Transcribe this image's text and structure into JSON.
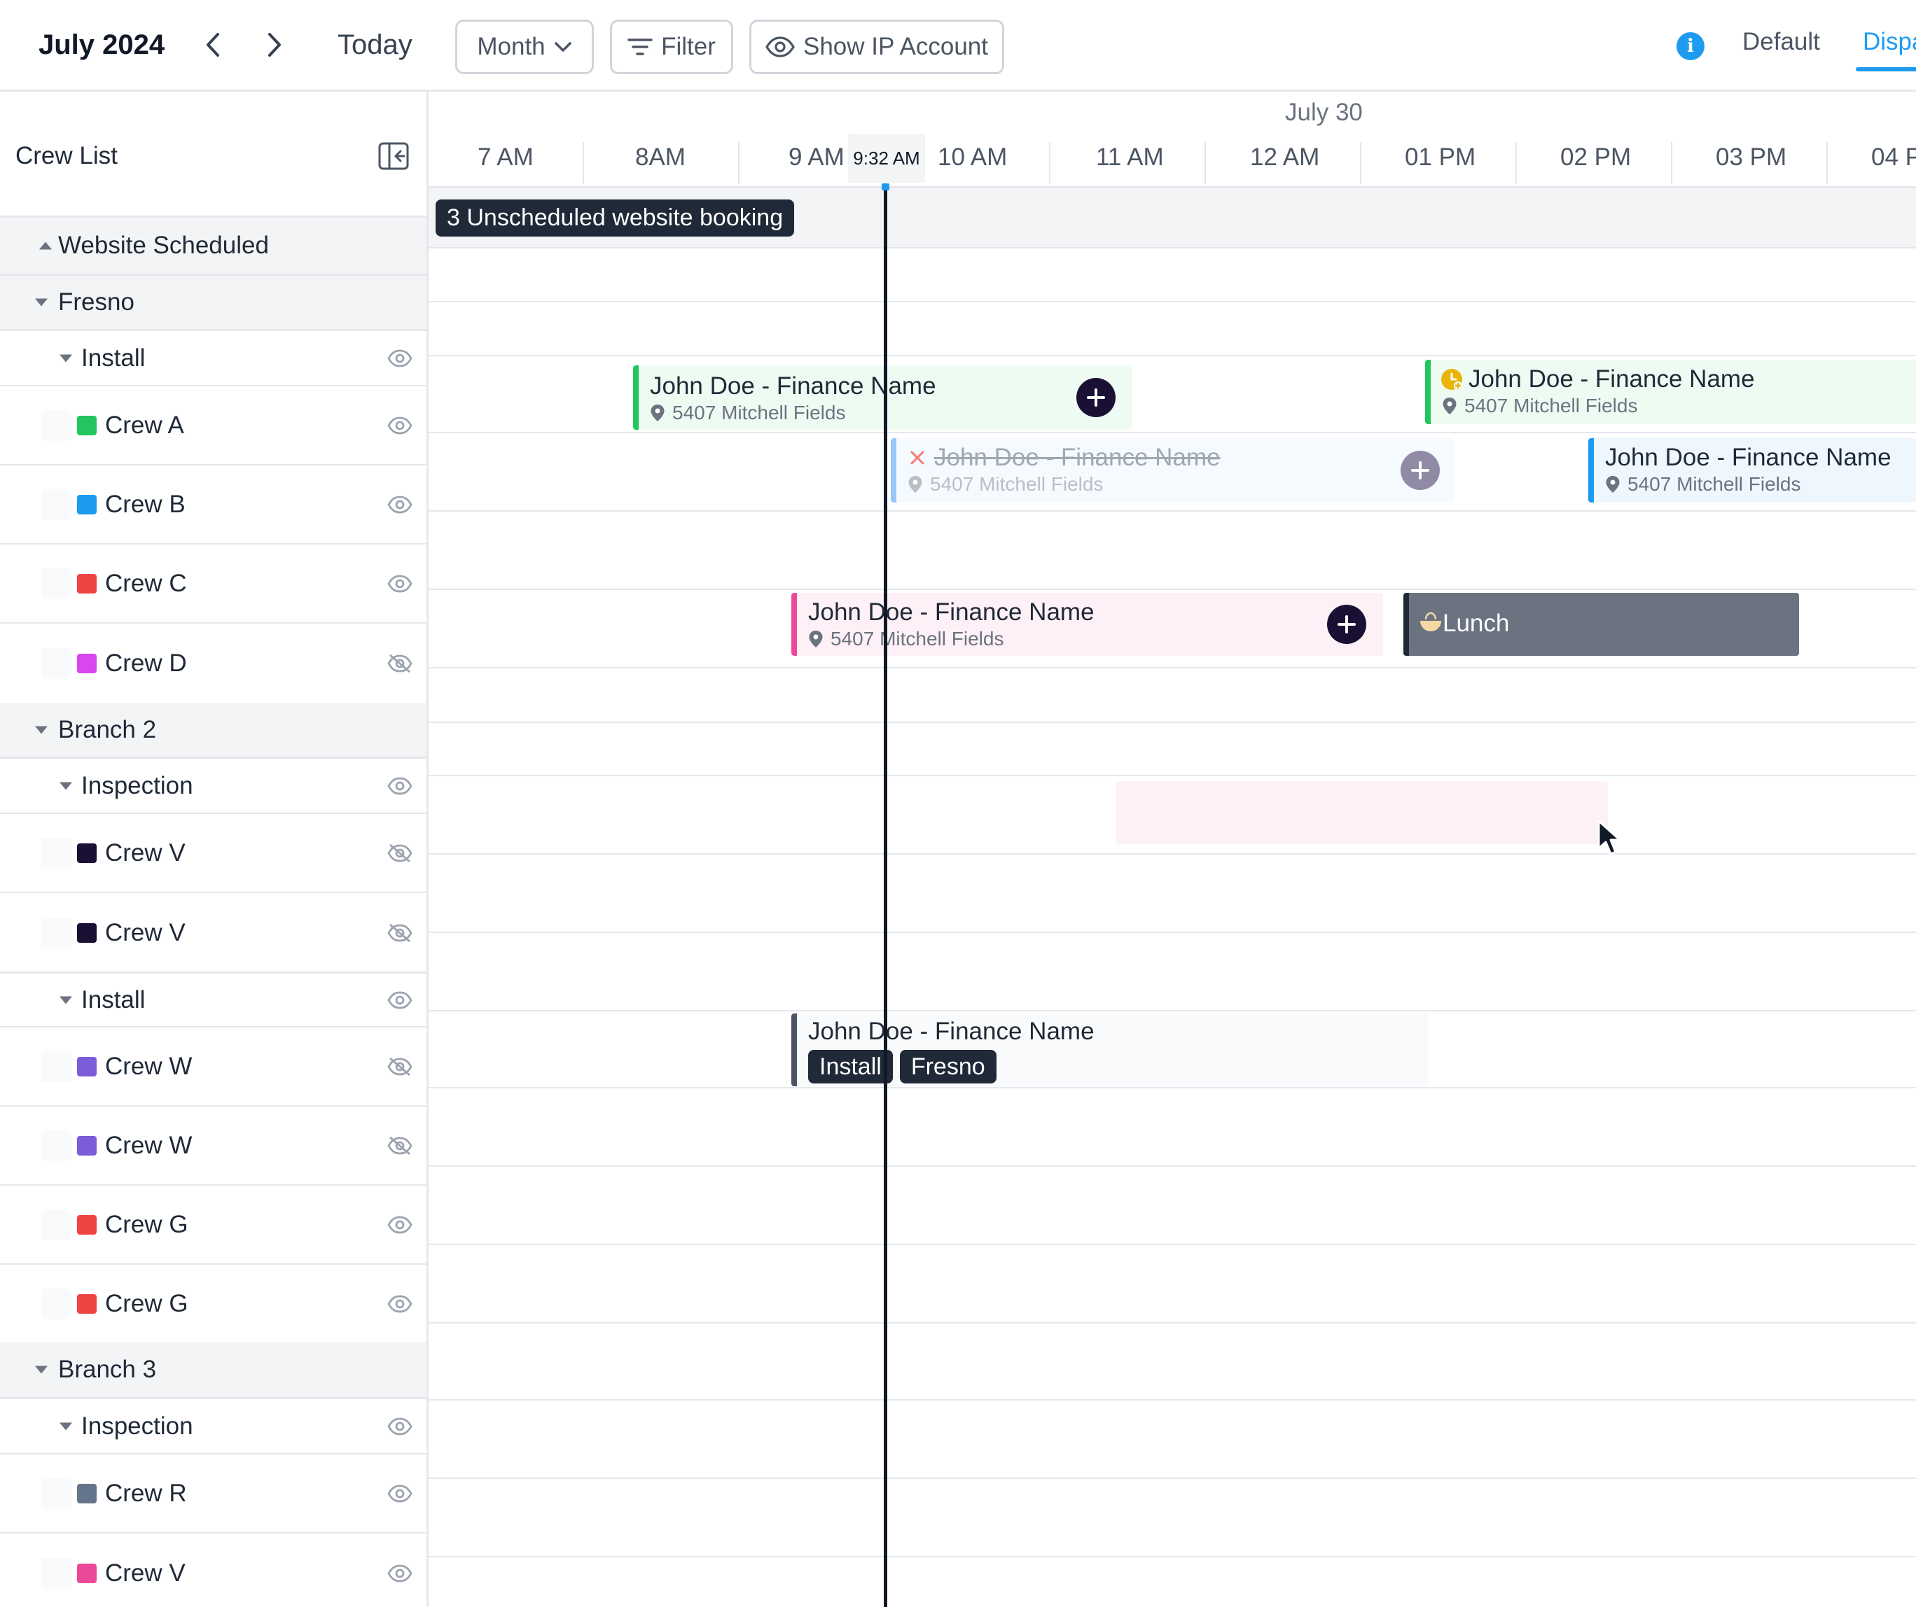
{
  "toolbar": {
    "title": "July 2024",
    "today_label": "Today",
    "view_select": "Month",
    "filter_label": "Filter",
    "show_ip_label": "Show IP Account",
    "info_icon": "i",
    "tabs": [
      {
        "label": "Default"
      },
      {
        "label": "Dispa"
      }
    ]
  },
  "panel": {
    "title": "Crew List",
    "rows": [
      {
        "label": "Website Scheduled"
      },
      {
        "label": "Fresno"
      },
      {
        "label": "Install"
      },
      {
        "label": "Crew A",
        "color": "#22c55e"
      },
      {
        "label": "Crew B",
        "color": "#1d9bf0"
      },
      {
        "label": "Crew C",
        "color": "#ef4444"
      },
      {
        "label": "Crew D",
        "color": "#d946ef"
      },
      {
        "label": "Branch 2"
      },
      {
        "label": "Inspection"
      },
      {
        "label": "Crew V",
        "color": "#1a1033"
      },
      {
        "label": "Crew V",
        "color": "#1a1033"
      },
      {
        "label": "Install"
      },
      {
        "label": "Crew W",
        "color": "#7c5cdb"
      },
      {
        "label": "Crew W",
        "color": "#7c5cdb"
      },
      {
        "label": "Crew G",
        "color": "#ef4444"
      },
      {
        "label": "Crew G",
        "color": "#ef4444"
      },
      {
        "label": "Branch 3"
      },
      {
        "label": "Inspection"
      },
      {
        "label": "Crew R",
        "color": "#64748b"
      },
      {
        "label": "Crew V",
        "color": "#ec4899"
      }
    ]
  },
  "timeline": {
    "date": "July 30",
    "now_time": "9:32 AM",
    "hours": [
      "7 AM",
      "8AM",
      "9 AM",
      "10 AM",
      "11 AM",
      "12 AM",
      "01 PM",
      "02 PM",
      "03 PM",
      "04 P"
    ]
  },
  "unscheduled_label": "3 Unscheduled website booking",
  "events": {
    "e1": {
      "title": "John Doe - Finance  Name",
      "location": "5407 Mitchell Fields"
    },
    "e2": {
      "title": "John Doe - Finance  Name",
      "location": "5407 Mitchell Fields"
    },
    "e3": {
      "title": "John Doe - Finance  Name",
      "location": "5407 Mitchell Fields",
      "status": "cancelled"
    },
    "e4": {
      "title": "John Doe - Finance  Name",
      "location": "5407 Mitchell Fields"
    },
    "e5": {
      "title": "John Doe - Finance  Name",
      "location": "5407 Mitchell Fields"
    },
    "lunch": {
      "title": "Lunch"
    },
    "e6": {
      "title": "John Doe - Finance  Name",
      "tags": [
        "Install",
        "Fresno"
      ]
    }
  },
  "colors": {
    "accent": "#1d9bf0",
    "dark": "#1f2937",
    "green": "#22c55e",
    "pink": "#ec4899",
    "blue": "#1d9bf0"
  }
}
